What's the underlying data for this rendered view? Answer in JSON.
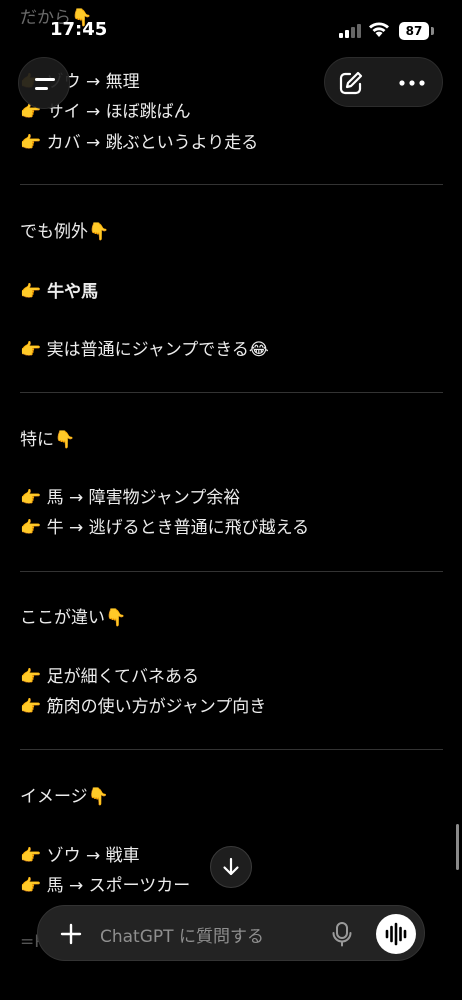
{
  "status_bar": {
    "time": "17:45",
    "battery": "87"
  },
  "content": {
    "partial_heading": "だから👇",
    "list1": [
      "👉 ゾウ → 無理",
      "👉 サイ → ほぼ跳ばん",
      "👉 カバ → 跳ぶというより走る"
    ],
    "section_exception": {
      "heading": "でも例外👇",
      "item1": "👉 牛や馬",
      "item2": "👉 実は普通にジャンプできる😂"
    },
    "section_especially": {
      "heading": "特に👇",
      "items": [
        "👉 馬 → 障害物ジャンプ余裕",
        "👉 牛 → 逃げるとき普通に飛び越える"
      ]
    },
    "section_difference": {
      "heading": "ここが違い👇",
      "items": [
        "👉 足が細くてバネある",
        "👉 筋肉の使い方がジャンプ向き"
      ]
    },
    "section_image": {
      "heading": "イメージ👇",
      "items": [
        "👉 ゾウ → 戦車",
        "👉 馬 → スポーツカー"
      ]
    },
    "partial_bottom": "=P"
  },
  "composer": {
    "placeholder": "ChatGPT に質問する"
  },
  "icons": {
    "menu": "menu-icon",
    "edit": "new-chat-icon",
    "more": "more-icon",
    "scroll_down": "arrow-down-icon",
    "plus": "plus-icon",
    "mic": "mic-icon",
    "voice": "voice-wave-icon"
  },
  "colors": {
    "background": "#000000",
    "text": "#ececec",
    "divider": "#333333",
    "composer": "#232323"
  }
}
